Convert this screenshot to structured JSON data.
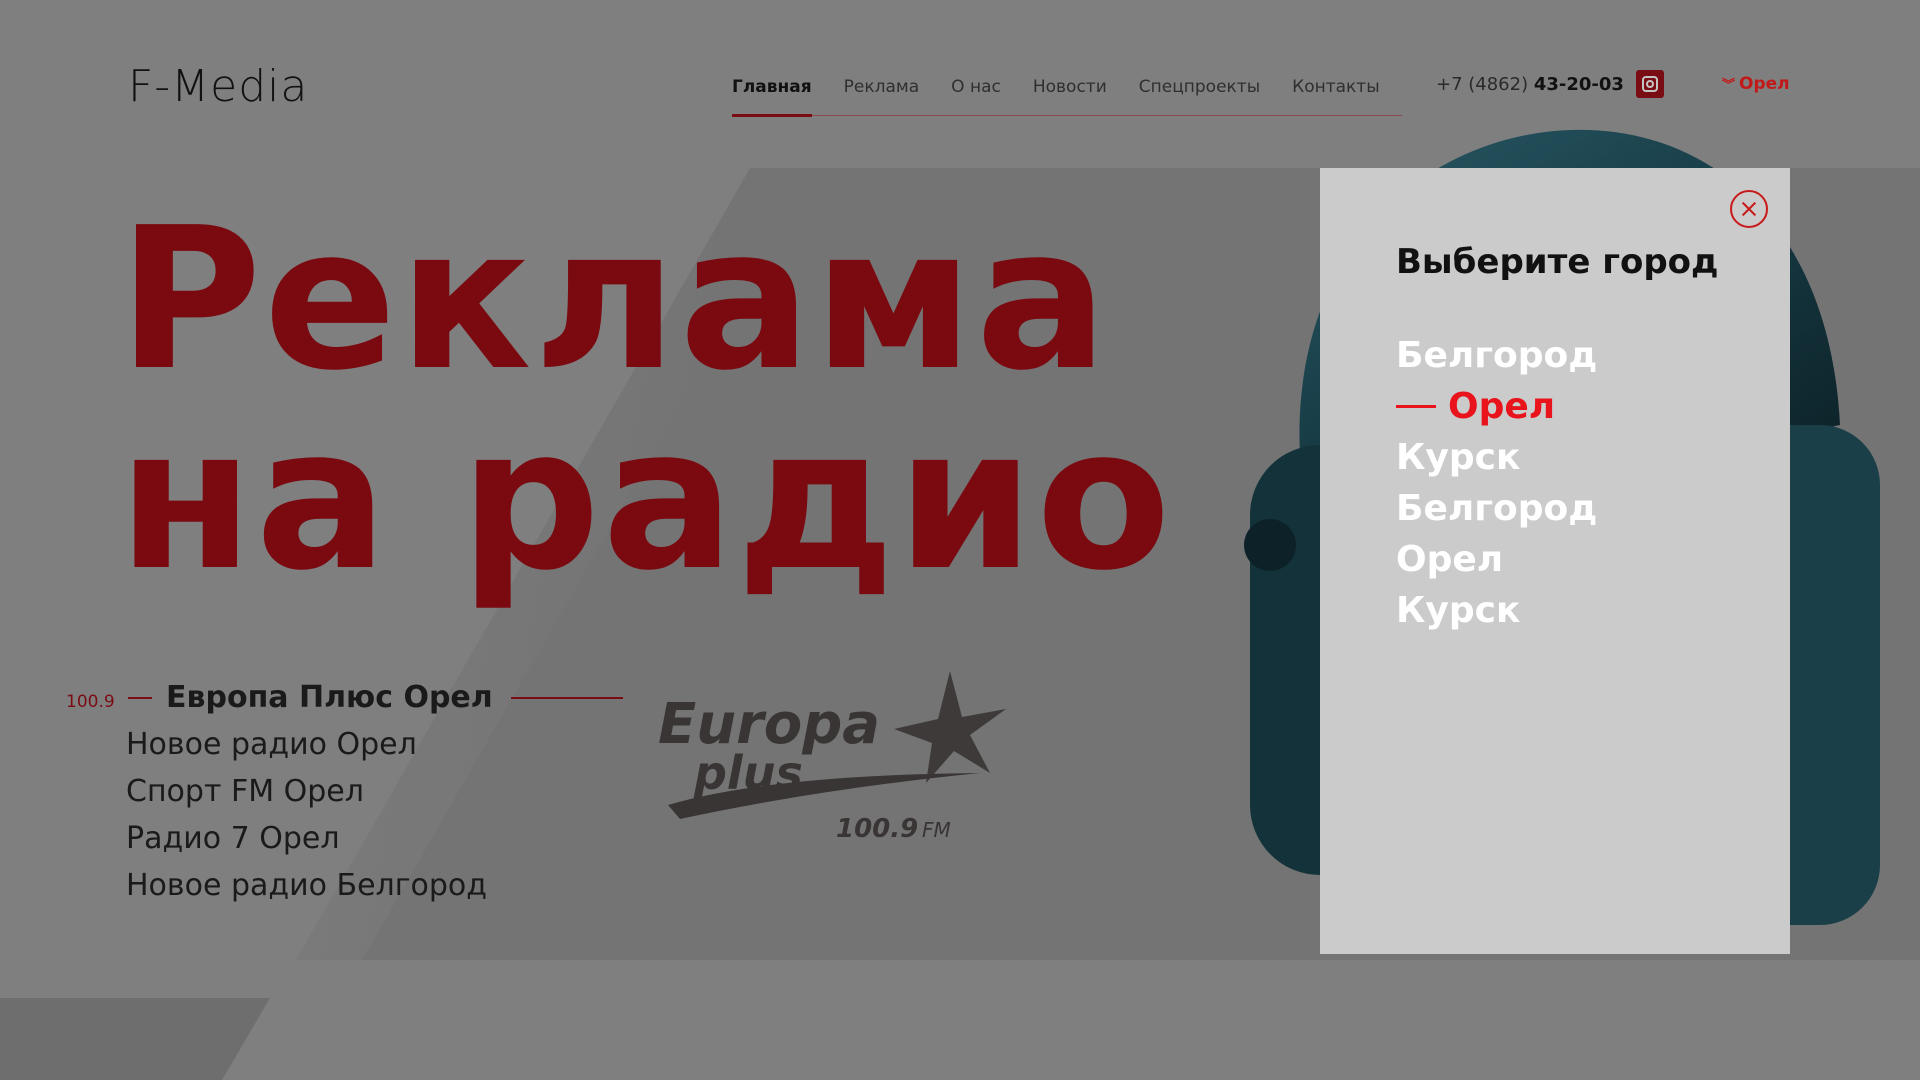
{
  "header": {
    "logo_text": "F-Media",
    "nav": [
      {
        "label": "Главная",
        "active": true
      },
      {
        "label": "Реклама",
        "active": false
      },
      {
        "label": "О нас",
        "active": false
      },
      {
        "label": "Новости",
        "active": false
      },
      {
        "label": "Спецпроекты",
        "active": false
      },
      {
        "label": "Контакты",
        "active": false
      }
    ],
    "phone_prefix": "+7 (4862)",
    "phone_main": "43-20-03",
    "instagram_icon": "instagram-icon",
    "city_label": "Орел",
    "city_icon": "double-chevron-down-icon"
  },
  "hero": {
    "title_line1": "Реклама",
    "title_line2": "на радио"
  },
  "stations": {
    "active_frequency": "100.9",
    "items": [
      {
        "label": "Европа Плюс Орел",
        "active": true
      },
      {
        "label": "Новое радио Орел",
        "active": false
      },
      {
        "label": "Спорт FM Орел",
        "active": false
      },
      {
        "label": "Радио 7 Орел",
        "active": false
      },
      {
        "label": "Новое радио Белгород",
        "active": false
      }
    ]
  },
  "station_logo": {
    "line1": "Europa",
    "line2": "plus",
    "freq": "100.9",
    "unit": "FM"
  },
  "modal": {
    "title": "Выберите город",
    "close_icon": "close-icon",
    "cities": [
      {
        "label": "Белгород",
        "active": false
      },
      {
        "label": "Орел",
        "active": true
      },
      {
        "label": "Курск",
        "active": false
      },
      {
        "label": "Белгород",
        "active": false
      },
      {
        "label": "Орел",
        "active": false
      },
      {
        "label": "Курск",
        "active": false
      }
    ]
  },
  "colors": {
    "overlay": "#7f7f7f",
    "brand_dark_red": "#7a0a10",
    "accent_red": "#e8131b",
    "modal_bg": "#cbcbcb"
  }
}
